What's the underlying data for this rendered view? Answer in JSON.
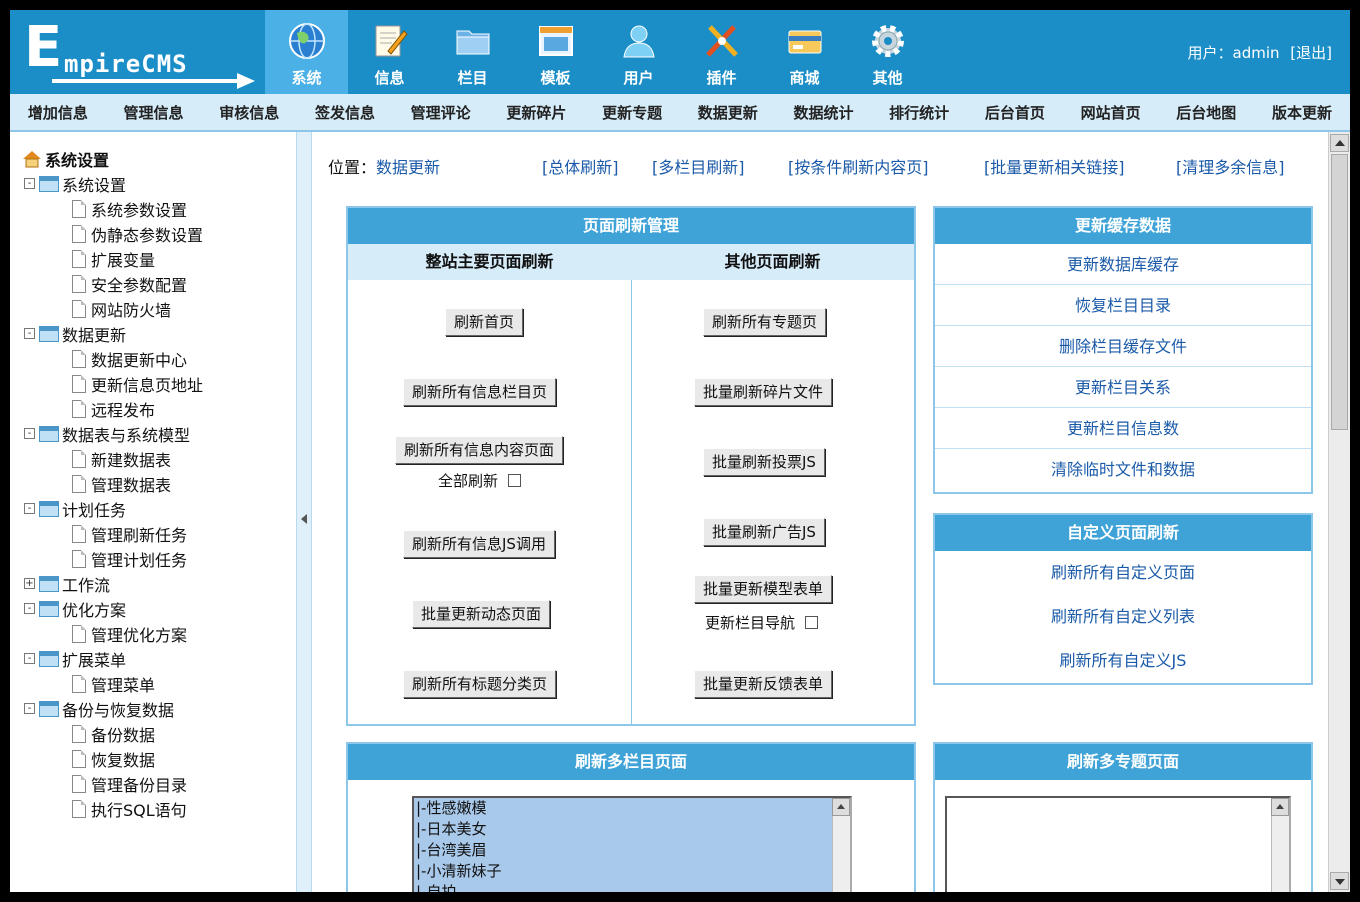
{
  "app": {
    "logo_letter": "E",
    "logo_rest": "mpireCMS"
  },
  "nav": [
    {
      "label": "系统",
      "icon": "globe-icon",
      "active": true
    },
    {
      "label": "信息",
      "icon": "notepad-pencil-icon"
    },
    {
      "label": "栏目",
      "icon": "folder-icon"
    },
    {
      "label": "模板",
      "icon": "window-template-icon"
    },
    {
      "label": "用户",
      "icon": "user-icon"
    },
    {
      "label": "插件",
      "icon": "plugin-tools-icon"
    },
    {
      "label": "商城",
      "icon": "credit-card-icon"
    },
    {
      "label": "其他",
      "icon": "gear-icon"
    }
  ],
  "user": {
    "prefix": "用户：",
    "name": "admin",
    "logout": "[退出]"
  },
  "submenu": [
    "增加信息",
    "管理信息",
    "审核信息",
    "签发信息",
    "管理评论",
    "更新碎片",
    "更新专题",
    "数据更新",
    "数据统计",
    "排行统计",
    "后台首页",
    "网站首页",
    "后台地图",
    "版本更新"
  ],
  "sidebar": {
    "root": "系统设置",
    "groups": [
      {
        "label": "系统设置",
        "expander": "-",
        "children": [
          "系统参数设置",
          "伪静态参数设置",
          "扩展变量",
          "安全参数配置",
          "网站防火墙"
        ]
      },
      {
        "label": "数据更新",
        "expander": "-",
        "children": [
          "数据更新中心",
          "更新信息页地址",
          "远程发布"
        ]
      },
      {
        "label": "数据表与系统模型",
        "expander": "-",
        "children": [
          "新建数据表",
          "管理数据表"
        ]
      },
      {
        "label": "计划任务",
        "expander": "-",
        "children": [
          "管理刷新任务",
          "管理计划任务"
        ]
      },
      {
        "label": "工作流",
        "expander": "+",
        "children": []
      },
      {
        "label": "优化方案",
        "expander": "-",
        "children": [
          "管理优化方案"
        ]
      },
      {
        "label": "扩展菜单",
        "expander": "-",
        "children": [
          "管理菜单"
        ]
      },
      {
        "label": "备份与恢复数据",
        "expander": "-",
        "children": [
          "备份数据",
          "恢复数据",
          "管理备份目录",
          "执行SQL语句"
        ]
      }
    ]
  },
  "location": {
    "prefix": "位置：",
    "current": "数据更新"
  },
  "toplinks": [
    "[总体刷新]",
    "[多栏目刷新]",
    "[按条件刷新内容页]",
    "[批量更新相关链接]",
    "[清理多余信息]"
  ],
  "refresh_panel": {
    "title": "页面刷新管理",
    "left_head": "整站主要页面刷新",
    "right_head": "其他页面刷新",
    "left_buttons": [
      "刷新首页",
      "刷新所有信息栏目页",
      "刷新所有信息内容页面",
      "刷新所有信息JS调用",
      "批量更新动态页面",
      "刷新所有标题分类页"
    ],
    "left_check": "全部刷新",
    "right_buttons": [
      "刷新所有专题页",
      "批量刷新碎片文件",
      "批量刷新投票JS",
      "批量刷新广告JS",
      "批量更新模型表单",
      "批量更新反馈表单"
    ],
    "right_check": "更新栏目导航"
  },
  "cache_panel": {
    "title": "更新缓存数据",
    "links": [
      "更新数据库缓存",
      "恢复栏目目录",
      "删除栏目缓存文件",
      "更新栏目关系",
      "更新栏目信息数",
      "清除临时文件和数据"
    ]
  },
  "custom_panel": {
    "title": "自定义页面刷新",
    "links": [
      "刷新所有自定义页面",
      "刷新所有自定义列表",
      "刷新所有自定义JS"
    ]
  },
  "multi_class_panel": {
    "title": "刷新多栏目页面",
    "options": [
      "|-性感嫩模",
      "|-日本美女",
      "|-台湾美眉",
      "|-小清新妹子",
      "|-自拍"
    ]
  },
  "multi_topic_panel": {
    "title": "刷新多专题页面"
  }
}
